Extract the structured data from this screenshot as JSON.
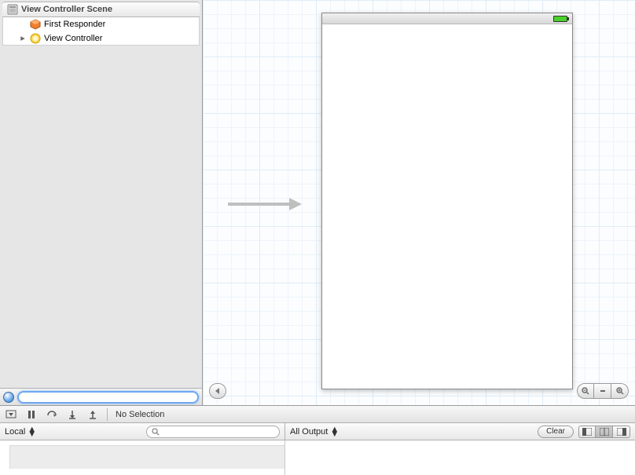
{
  "outline": {
    "scene_title": "View Controller Scene",
    "items": [
      {
        "label": "First Responder",
        "has_children": false,
        "icon": "cube-orange"
      },
      {
        "label": "View Controller",
        "has_children": true,
        "icon": "circle-yellow"
      }
    ],
    "filter_placeholder": ""
  },
  "debugbar": {
    "no_selection": "No Selection"
  },
  "console": {
    "left_scope": "Local",
    "search_placeholder": "",
    "right_scope": "All Output",
    "clear_label": "Clear"
  }
}
